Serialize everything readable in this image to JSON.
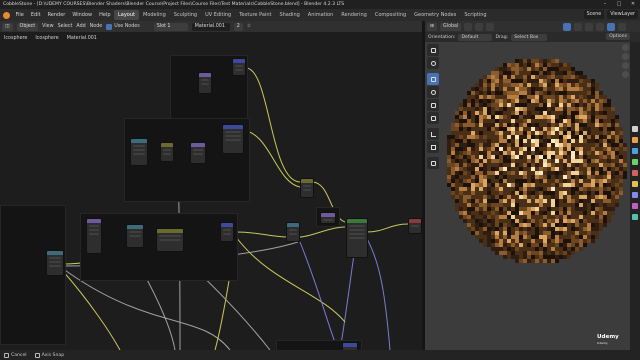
{
  "window": {
    "title": "CobbleStone - [D:\\UDEMY COURSES\\Blender Shaders\\Blender Course\\Project Files\\Course Files\\Test Materials\\CobbleStone.blend] - Blender 4.2.3 LTS",
    "controls": [
      "–",
      "□",
      "✕"
    ]
  },
  "menu": {
    "items": [
      "File",
      "Edit",
      "Render",
      "Window",
      "Help"
    ],
    "workspaces": [
      "Layout",
      "Modeling",
      "Sculpting",
      "UV Editing",
      "Texture Paint",
      "Shading",
      "Animation",
      "Rendering",
      "Compositing",
      "Geometry Nodes",
      "Scripting"
    ],
    "active_workspace": "Layout",
    "scene": "Scene",
    "view_layer": "ViewLayer"
  },
  "node_editor": {
    "header": {
      "mode": "Object",
      "menus": [
        "View",
        "Select",
        "Add",
        "Node"
      ],
      "use_nodes": "Use Nodes",
      "slot": "Slot 1",
      "material": "Material.001",
      "users": "2"
    },
    "breadcrumb": [
      "Icosphere",
      "Icosphere",
      "Material.001"
    ]
  },
  "viewport": {
    "header": {
      "orientation_global": "Global",
      "icons": [
        "cursor-icon",
        "move-icon",
        "rotate-icon",
        "scale-icon",
        "transform-icon",
        "annotate-icon",
        "measure-icon",
        "add-cube-icon"
      ]
    },
    "tool_settings": {
      "orientation_label": "Orientation:",
      "orientation": "Default",
      "drag_label": "Drag:",
      "drag": "Select Box",
      "options": "Options"
    },
    "tools": [
      "tweak-tool-icon",
      "cursor-tool-icon",
      "move-tool-icon",
      "rotate-tool-icon",
      "scale-tool-icon",
      "transform-tool-icon",
      "annotate-tool-icon",
      "measure-tool-icon",
      "add-cube-tool-icon"
    ],
    "active_tool": "move-tool-icon",
    "watermark": {
      "brand": "Udemy",
      "sub": "Udemy"
    },
    "property_tab_colors": [
      "#cfcfcf",
      "#e8a04a",
      "#4aa3df",
      "#6fcf6f",
      "#d35f5f",
      "#e0c050",
      "#8888ee",
      "#c05fc0",
      "#55c0b0"
    ]
  },
  "status": {
    "items": [
      {
        "key": "mouse-left",
        "label": "Cancel"
      },
      {
        "key": "mouse-middle",
        "label": "Axis Snap"
      }
    ]
  },
  "colors": {
    "accent": "#4772b3",
    "link_yellow": "#c8c85a",
    "link_purple": "#7a7ad6",
    "link_gray": "#a1a1a1",
    "node_header_texture": "#6c5a9c",
    "node_header_vector": "#3b4a9c",
    "node_header_color": "#6b6b2f",
    "node_header_converter": "#3c6b7c",
    "node_header_shader": "#397a3a"
  }
}
